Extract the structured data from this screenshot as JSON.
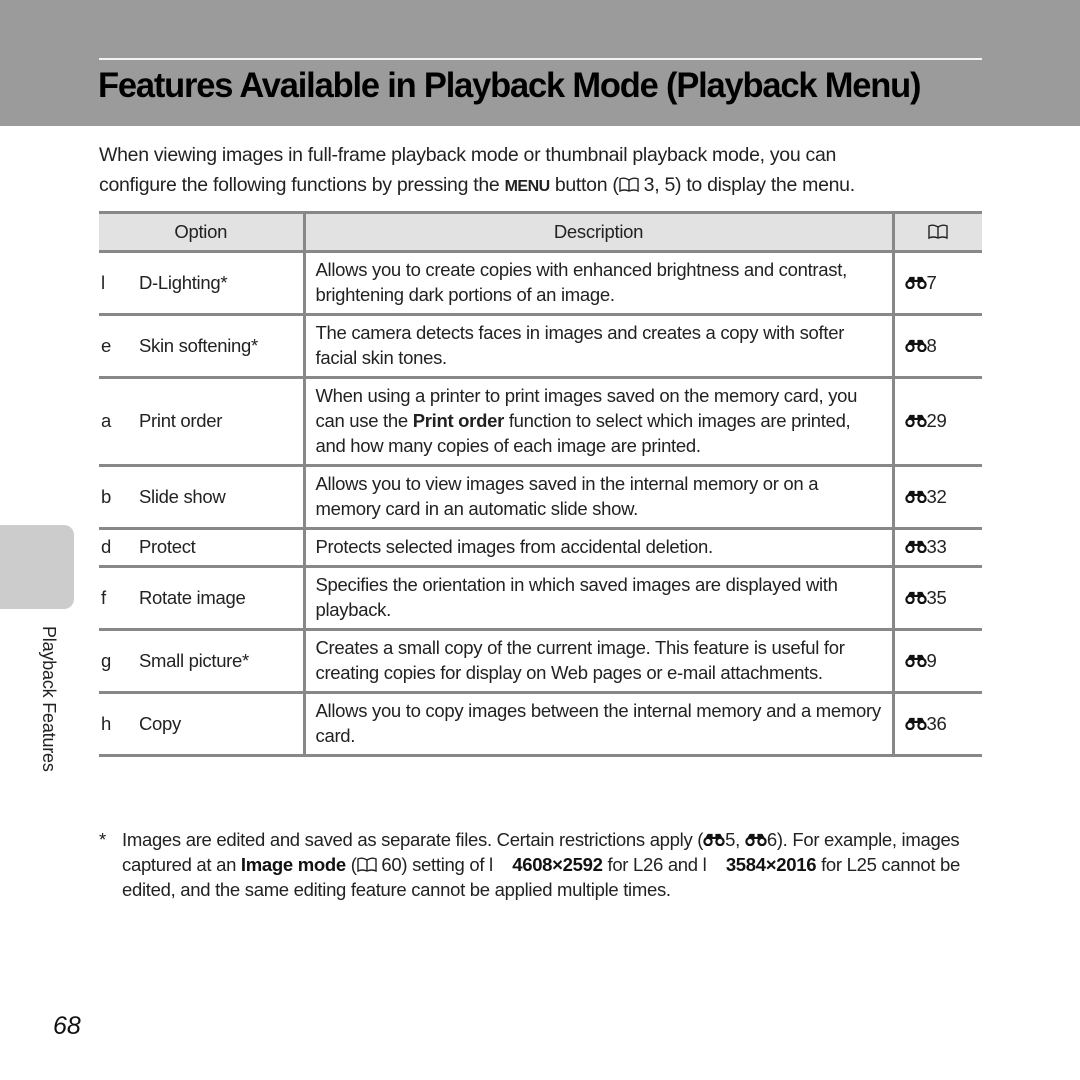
{
  "header": {
    "title": "Features Available in Playback Mode (Playback Menu)"
  },
  "intro": {
    "line1": "When viewing images in full-frame playback mode or thumbnail playback mode, you can",
    "line2_pre": "configure the following functions by pressing the ",
    "menu_glyph": "MENU",
    "line2_mid": " button (",
    "line2_ref": " 3, 5) to display the menu."
  },
  "table": {
    "headers": {
      "option": "Option",
      "description": "Description",
      "reference_icon": "book-icon"
    },
    "rows": [
      {
        "icon_glyph": "l",
        "option": "D-Lighting*",
        "description": "Allows you to create copies with enhanced brightness and contrast, brightening dark portions of an image.",
        "ref_icon": "binoculars-icon",
        "ref": "7"
      },
      {
        "icon_glyph": "e",
        "option": "Skin softening*",
        "description": "The camera detects faces in images and creates a copy with softer facial skin tones.",
        "ref_icon": "binoculars-icon",
        "ref": "8"
      },
      {
        "icon_glyph": "a",
        "option": "Print order",
        "description_pre": "When using a printer to print images saved on the memory card, you can use the ",
        "description_bold": "Print order",
        "description_post": " function to select which images are printed, and how many copies of each image are printed.",
        "ref_icon": "binoculars-icon",
        "ref": "29"
      },
      {
        "icon_glyph": "b",
        "option": "Slide show",
        "description": "Allows you to view images saved in the internal memory or on a memory card in an automatic slide show.",
        "ref_icon": "binoculars-icon",
        "ref": "32"
      },
      {
        "icon_glyph": "d",
        "option": "Protect",
        "description": "Protects selected images from accidental deletion.",
        "ref_icon": "binoculars-icon",
        "ref": "33"
      },
      {
        "icon_glyph": "f",
        "option": "Rotate image",
        "description": "Specifies the orientation in which saved images are displayed with playback.",
        "ref_icon": "binoculars-icon",
        "ref": "35"
      },
      {
        "icon_glyph": "g",
        "option": "Small picture*",
        "description": "Creates a small copy of the current image. This feature is useful for creating copies for display on Web pages or e-mail attachments.",
        "ref_icon": "binoculars-icon",
        "ref": "9"
      },
      {
        "icon_glyph": "h",
        "option": "Copy",
        "description": "Allows you to copy images between the internal memory and a memory card.",
        "ref_icon": "binoculars-icon",
        "ref": "36"
      }
    ]
  },
  "footnote": {
    "marker": "*",
    "t1": "Images are edited and saved as separate files. Certain restrictions apply (",
    "ref1": "5",
    "t2": ", ",
    "ref2": "6",
    "t3": "). For example, images captured at an ",
    "bold1": "Image mode",
    "t4": " (",
    "ref3": " 60",
    "t5": ") setting of ",
    "glyph1": "l",
    "bold2": "4608×2592",
    "t6": " for L26 and ",
    "glyph2": "l",
    "bold3": "3584×2016",
    "t7": " for L25 cannot be edited, and the same editing feature cannot be applied multiple times."
  },
  "sidebar": {
    "section_label": "Playback Features"
  },
  "page_number": "68",
  "colors": {
    "header_band": "#9b9b9b",
    "table_header_bg": "#e2e2e2",
    "rule": "#888888",
    "side_tab": "#cccccc"
  }
}
